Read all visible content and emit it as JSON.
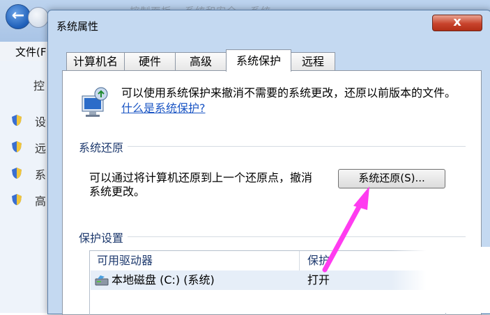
{
  "background": {
    "address_fragment": "...控制面板 ▸ 系统和安全 ▸ 系统",
    "menu_file": "文件(F",
    "control_label": "控",
    "left_items": [
      "设",
      "远",
      "系",
      "高"
    ]
  },
  "dialog": {
    "title": "系统属性",
    "close_glyph": "x",
    "tabs": [
      "计算机名",
      "硬件",
      "高级",
      "系统保护",
      "远程"
    ],
    "active_tab": "系统保护",
    "intro_text": "可以使用系统保护来撤消不需要的系统更改，还原以前版本的文件。",
    "intro_link": "什么是系统保护?",
    "restore_group_label": "系统还原",
    "restore_desc": "可以通过将计算机还原到上一个还原点，撤消系统更改。",
    "restore_button": "系统还原(S)...",
    "protection_group_label": "保护设置",
    "table_headers": [
      "可用驱动器",
      "保护"
    ],
    "rows": [
      {
        "drive": "本地磁盘 (C:) (系统)",
        "protection": "打开"
      }
    ],
    "colors": {
      "accent_arrow": "#ff3cf0",
      "link": "#1a55c4"
    }
  }
}
